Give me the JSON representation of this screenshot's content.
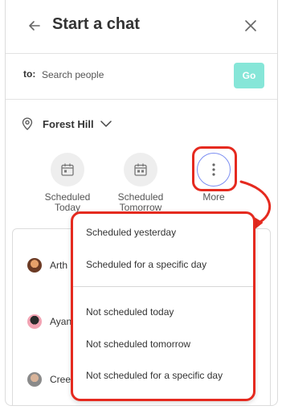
{
  "header": {
    "title": "Start a chat",
    "back_icon": "arrow-left-icon",
    "close_icon": "close-icon"
  },
  "to_row": {
    "label": "to:",
    "search_placeholder": "Search people",
    "go_label": "Go"
  },
  "location": {
    "name": "Forest Hill",
    "pin_icon": "location-pin-icon",
    "chevron_icon": "chevron-down-icon"
  },
  "quick_actions": [
    {
      "label_line1": "Scheduled",
      "label_line2": "Today",
      "icon": "calendar-icon"
    },
    {
      "label_line1": "Scheduled",
      "label_line2": "Tomorrow",
      "icon": "calendar-icon"
    },
    {
      "label_line1": "More",
      "label_line2": "",
      "icon": "more-vertical-icon"
    }
  ],
  "people": [
    {
      "name": "Arth"
    },
    {
      "name": "Ayan"
    },
    {
      "name": "Cree"
    }
  ],
  "dropdown": {
    "group1": [
      "Scheduled yesterday",
      "Scheduled for a specific day"
    ],
    "group2": [
      "Not scheduled today",
      "Not scheduled tomorrow",
      "Not scheduled for a specific day"
    ]
  },
  "colors": {
    "accent_teal": "#86e6d8",
    "highlight_red": "#e52a1f",
    "more_ring": "#7d8ff2"
  }
}
